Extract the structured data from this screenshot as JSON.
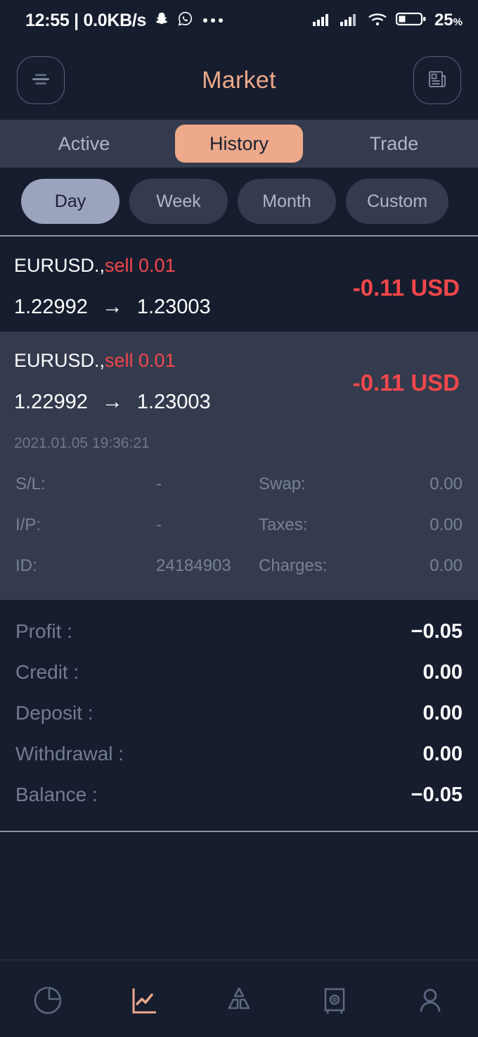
{
  "status_bar": {
    "time": "12:55",
    "separator": "|",
    "data_speed": "0.0KB/s",
    "icons": [
      "snapchat-icon",
      "whatsapp-icon",
      "more-dots-icon"
    ],
    "signal_icons": [
      "signal-bars-icon",
      "signal-bars-icon",
      "wifi-icon"
    ],
    "battery_percent": "25",
    "battery_percent_symbol": "%"
  },
  "header": {
    "menu_icon": "hamburger-menu-icon",
    "title": "Market",
    "news_icon": "newspaper-icon",
    "title_color": "#eda989"
  },
  "tabs": {
    "items": [
      {
        "label": "Active",
        "active": false
      },
      {
        "label": "History",
        "active": true
      },
      {
        "label": "Trade",
        "active": false
      }
    ],
    "active_bg": "#eda989"
  },
  "period_filters": {
    "items": [
      {
        "label": "Day",
        "active": true
      },
      {
        "label": "Week",
        "active": false
      },
      {
        "label": "Month",
        "active": false
      },
      {
        "label": "Custom",
        "active": false
      }
    ],
    "active_bg": "#9ba3bd"
  },
  "trades": [
    {
      "symbol": "EURUSD.,",
      "side": "sell 0.01",
      "open_price": "1.22992",
      "arrow": "→",
      "close_price": "1.23003",
      "profit": "-0.11 USD",
      "profit_color": "#f5474b",
      "expanded": false
    },
    {
      "symbol": "EURUSD.,",
      "side": "sell 0.01",
      "open_price": "1.22992",
      "arrow": "→",
      "close_price": "1.23003",
      "profit": "-0.11 USD",
      "profit_color": "#f5474b",
      "expanded": true,
      "time": "2021.01.05 19:36:21",
      "details": {
        "sl_label": "S/L:",
        "sl_value": "-",
        "swap_label": "Swap:",
        "swap_value": "0.00",
        "ip_label": "I/P:",
        "ip_value": "-",
        "taxes_label": "Taxes:",
        "taxes_value": "0.00",
        "id_label": "ID:",
        "id_value": "24184903",
        "charges_label": "Charges:",
        "charges_value": "0.00"
      }
    }
  ],
  "summary": {
    "rows": [
      {
        "label": "Profit :",
        "value": "−0.05"
      },
      {
        "label": "Credit :",
        "value": "0.00"
      },
      {
        "label": "Deposit :",
        "value": "0.00"
      },
      {
        "label": "Withdrawal :",
        "value": "0.00"
      },
      {
        "label": "Balance :",
        "value": "−0.05"
      }
    ]
  },
  "bottom_nav": {
    "items": [
      {
        "icon": "pie-chart-icon",
        "active": false
      },
      {
        "icon": "line-chart-icon",
        "active": true
      },
      {
        "icon": "pyramid-icon",
        "active": false
      },
      {
        "icon": "settings-board-icon",
        "active": false
      },
      {
        "icon": "profile-person-icon",
        "active": false
      }
    ],
    "active_color": "#eda989",
    "inactive_color": "#5d6781"
  }
}
